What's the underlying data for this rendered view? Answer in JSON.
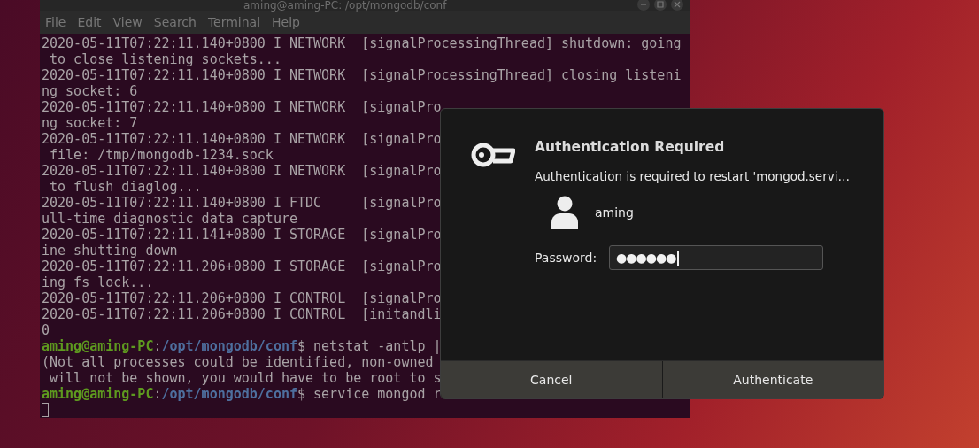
{
  "terminal": {
    "title": "aming@aming-PC: /opt/mongodb/conf",
    "menu": [
      "File",
      "Edit",
      "View",
      "Search",
      "Terminal",
      "Help"
    ],
    "lines": [
      {
        "kind": "output",
        "text": "2020-05-11T07:22:11.140+0800 I NETWORK  [signalProcessingThread] shutdown: going"
      },
      {
        "kind": "output",
        "text": " to close listening sockets..."
      },
      {
        "kind": "output",
        "text": "2020-05-11T07:22:11.140+0800 I NETWORK  [signalProcessingThread] closing listeni"
      },
      {
        "kind": "output",
        "text": "ng socket: 6"
      },
      {
        "kind": "output",
        "text": "2020-05-11T07:22:11.140+0800 I NETWORK  [signalPro"
      },
      {
        "kind": "output",
        "text": "ng socket: 7"
      },
      {
        "kind": "output",
        "text": "2020-05-11T07:22:11.140+0800 I NETWORK  [signalPro"
      },
      {
        "kind": "output",
        "text": " file: /tmp/mongodb-1234.sock"
      },
      {
        "kind": "output",
        "text": "2020-05-11T07:22:11.140+0800 I NETWORK  [signalPro"
      },
      {
        "kind": "output",
        "text": " to flush diaglog..."
      },
      {
        "kind": "output",
        "text": "2020-05-11T07:22:11.140+0800 I FTDC     [signalPro"
      },
      {
        "kind": "output",
        "text": "ull-time diagnostic data capture"
      },
      {
        "kind": "output",
        "text": "2020-05-11T07:22:11.141+0800 I STORAGE  [signalPro"
      },
      {
        "kind": "output",
        "text": "ine shutting down"
      },
      {
        "kind": "output",
        "text": "2020-05-11T07:22:11.206+0800 I STORAGE  [signalPro"
      },
      {
        "kind": "output",
        "text": "ing fs lock..."
      },
      {
        "kind": "output",
        "text": "2020-05-11T07:22:11.206+0800 I CONTROL  [signalPro"
      },
      {
        "kind": "output",
        "text": "2020-05-11T07:22:11.206+0800 I CONTROL  [initandli"
      },
      {
        "kind": "output",
        "text": "0"
      },
      {
        "kind": "prompt",
        "user": "aming@aming-PC",
        "separator": ":",
        "path": "/opt/mongodb/conf",
        "command": "$ netstat -antlp |"
      },
      {
        "kind": "output",
        "text": "(Not all processes could be identified, non-owned"
      },
      {
        "kind": "output",
        "text": " will not be shown, you would have to be root to s"
      },
      {
        "kind": "prompt",
        "user": "aming@aming-PC",
        "separator": ":",
        "path": "/opt/mongodb/conf",
        "command": "$ service mongod r"
      },
      {
        "kind": "cursor"
      }
    ]
  },
  "dialog": {
    "title": "Authentication Required",
    "message": "Authentication is required to restart 'mongod.servi…",
    "user": "aming",
    "password_label": "Password:",
    "password_value": "●●●●●●",
    "buttons": [
      "Cancel",
      "Authenticate"
    ]
  }
}
